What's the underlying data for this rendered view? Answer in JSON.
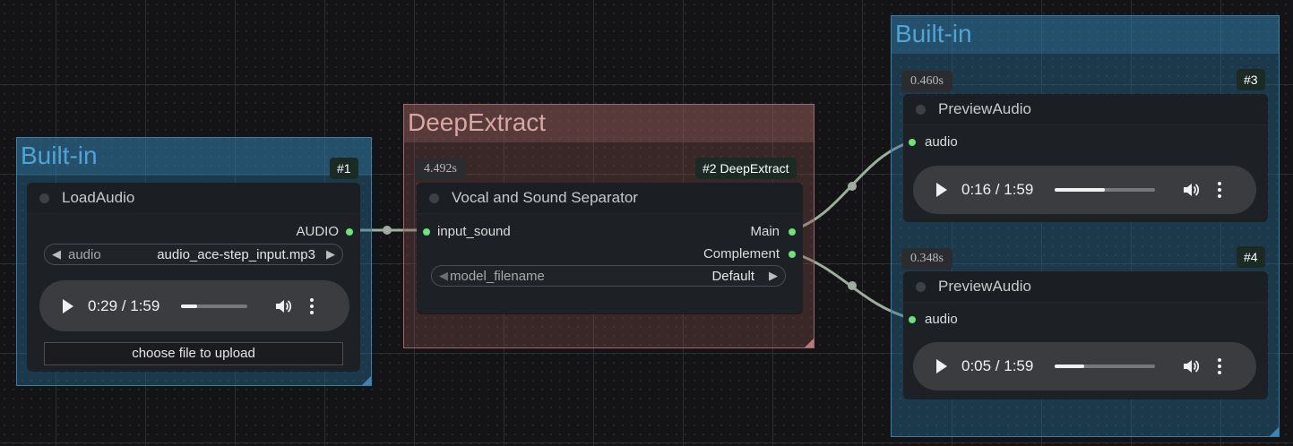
{
  "groups": {
    "left": {
      "title": "Built-in"
    },
    "middle": {
      "title": "DeepExtract"
    },
    "right": {
      "title": "Built-in"
    }
  },
  "nodes": {
    "load_audio": {
      "badge": "#1",
      "title": "LoadAudio",
      "output_label": "AUDIO",
      "combo": {
        "label": "audio",
        "value": "audio_ace-step_input.mp3"
      },
      "player": {
        "time": "0:29 / 1:59",
        "progress": 0.24
      },
      "upload_label": "choose file to upload"
    },
    "separator": {
      "timer": "4.492s",
      "badge": "#2 DeepExtract",
      "title": "Vocal and Sound Separator",
      "input_label": "input_sound",
      "outputs": [
        "Main",
        "Complement"
      ],
      "combo": {
        "label": "model_filename",
        "value": "Default"
      }
    },
    "preview1": {
      "timer": "0.460s",
      "badge": "#3",
      "title": "PreviewAudio",
      "input_label": "audio",
      "player": {
        "time": "0:16 / 1:59",
        "progress": 0.5
      }
    },
    "preview2": {
      "timer": "0.348s",
      "badge": "#4",
      "title": "PreviewAudio",
      "input_label": "audio",
      "player": {
        "time": "0:05 / 1:59",
        "progress": 0.29
      }
    }
  },
  "colors": {
    "slot_dot": "#6fe07a",
    "link": "#9fad9f",
    "group_blue": "#3a7ea6",
    "group_red": "#9a6a6a"
  },
  "icons": [
    "play-icon",
    "volume-icon",
    "more-vertical-icon",
    "arrow-left-icon",
    "arrow-right-icon"
  ]
}
